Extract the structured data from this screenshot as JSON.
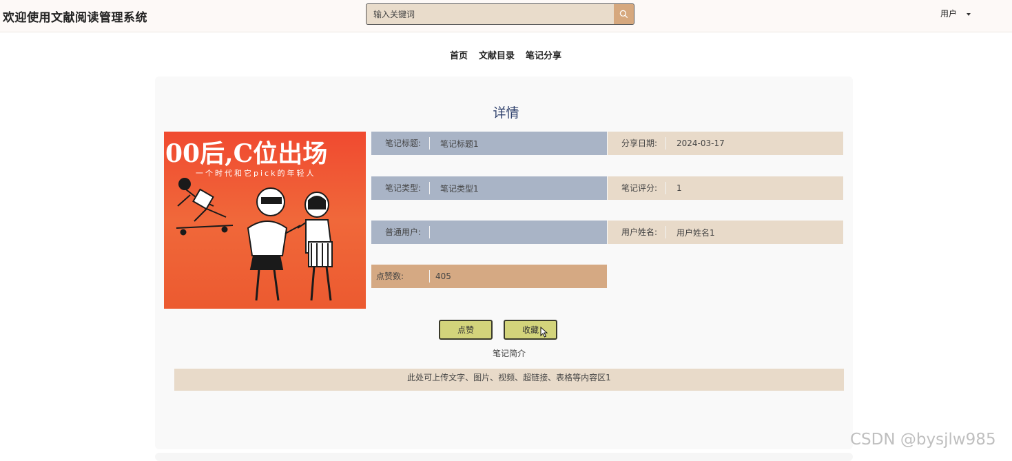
{
  "header": {
    "site_title": "欢迎使用文献阅读管理系统",
    "search_placeholder": "输入关键词",
    "user_label": "用户"
  },
  "nav": {
    "items": [
      "首页",
      "文献目录",
      "笔记分享"
    ]
  },
  "detail": {
    "title": "详情",
    "cover": {
      "title_text": "00后,C位出场",
      "subtitle_text": "一个时代和它pick的年轻人"
    },
    "fields": [
      {
        "label": "笔记标题:",
        "value": "笔记标题1"
      },
      {
        "label": "分享日期:",
        "value": "2024-03-17"
      },
      {
        "label": "笔记类型:",
        "value": "笔记类型1"
      },
      {
        "label": "笔记评分:",
        "value": "1"
      },
      {
        "label": "普通用户:",
        "value": ""
      },
      {
        "label": "用户姓名:",
        "value": "用户姓名1"
      },
      {
        "label": "点赞数:",
        "value": "405"
      }
    ],
    "buttons": {
      "like": "点赞",
      "favorite": "收藏"
    },
    "intro_label": "笔记简介",
    "intro_content": "此处可上传文字、图片、视频、超链接、表格等内容区1"
  },
  "watermark": "CSDN @bysjlw985",
  "colors": {
    "accent_blue": "#a9b4c6",
    "beige": "#e8dac9",
    "tan": "#d5a983",
    "button": "#d3d47b",
    "cover_orange": "#f04a30"
  }
}
